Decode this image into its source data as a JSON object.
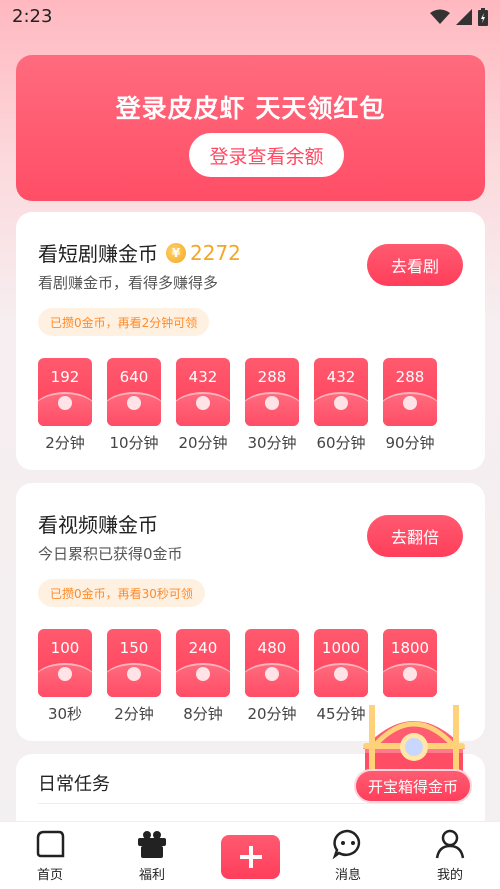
{
  "status_bar": {
    "time": "2:23",
    "icons": [
      "wifi-icon",
      "signal-icon",
      "battery-charging-icon"
    ]
  },
  "banner": {
    "title": "登录皮皮虾 天天领红包",
    "button_label": "登录查看余额"
  },
  "short_drama": {
    "title": "看短剧赚金币",
    "coin_amount": "2272",
    "subtitle": "看剧赚金币，看得多赚得多",
    "action_label": "去看剧",
    "hint": "已攒0金币，再看2分钟可领",
    "packets": [
      {
        "amount": "192",
        "label": "2分钟"
      },
      {
        "amount": "640",
        "label": "10分钟"
      },
      {
        "amount": "432",
        "label": "20分钟"
      },
      {
        "amount": "288",
        "label": "30分钟"
      },
      {
        "amount": "432",
        "label": "60分钟"
      },
      {
        "amount": "288",
        "label": "90分钟"
      }
    ]
  },
  "video": {
    "title": "看视频赚金币",
    "subtitle": "今日累积已获得0金币",
    "action_label": "去翻倍",
    "hint": "已攒0金币，再看30秒可领",
    "packets": [
      {
        "amount": "100",
        "label": "30秒"
      },
      {
        "amount": "150",
        "label": "2分钟"
      },
      {
        "amount": "240",
        "label": "8分钟"
      },
      {
        "amount": "480",
        "label": "20分钟"
      },
      {
        "amount": "1000",
        "label": "45分钟"
      },
      {
        "amount": "1800",
        "label": ""
      }
    ]
  },
  "daily": {
    "title": "日常任务"
  },
  "chest": {
    "label": "开宝箱得金币"
  },
  "tabbar": {
    "items": [
      {
        "label": "首页",
        "icon": "home-icon"
      },
      {
        "label": "福利",
        "icon": "gift-icon"
      },
      {
        "label": "",
        "icon": "plus-icon"
      },
      {
        "label": "消息",
        "icon": "message-icon"
      },
      {
        "label": "我的",
        "icon": "profile-icon"
      }
    ]
  },
  "colors": {
    "accent": "#ff4a62",
    "coin": "#f5a623",
    "hint_text": "#ff8a2a"
  }
}
